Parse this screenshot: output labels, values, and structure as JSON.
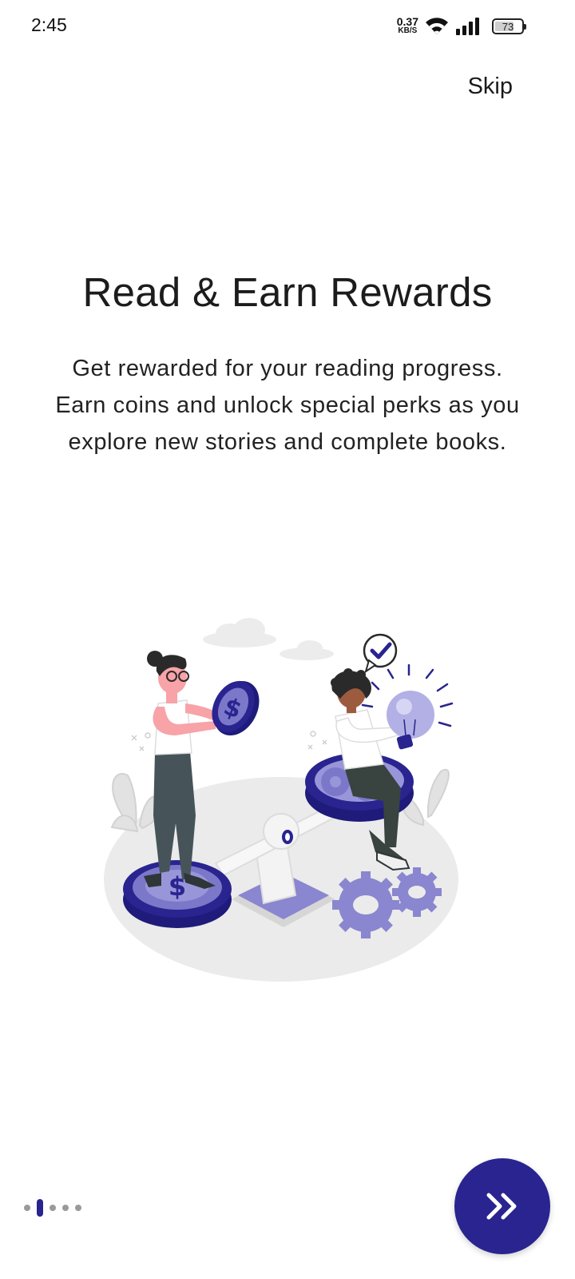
{
  "status_bar": {
    "time": "2:45",
    "net_speed_value": "0.37",
    "net_speed_unit": "KB/S",
    "wifi_icon": "wifi-icon",
    "signal_icon": "cellular-signal-icon",
    "battery_level": "73"
  },
  "onboarding": {
    "skip_label": "Skip",
    "title": "Read & Earn Rewards",
    "description_lines": [
      "Get rewarded for your reading progress.",
      "Earn coins and unlock special perks as you",
      "explore new stories and complete books."
    ],
    "illustration_icon": "rewards-illustration",
    "page_count": 5,
    "current_page": 1,
    "next_icon": "double-chevron-right-icon"
  },
  "colors": {
    "primary": "#29248f",
    "primary_light": "#7b78c9",
    "inactive_dot": "#9a9a9a",
    "text": "#1c1c1c",
    "background": "#ffffff"
  }
}
